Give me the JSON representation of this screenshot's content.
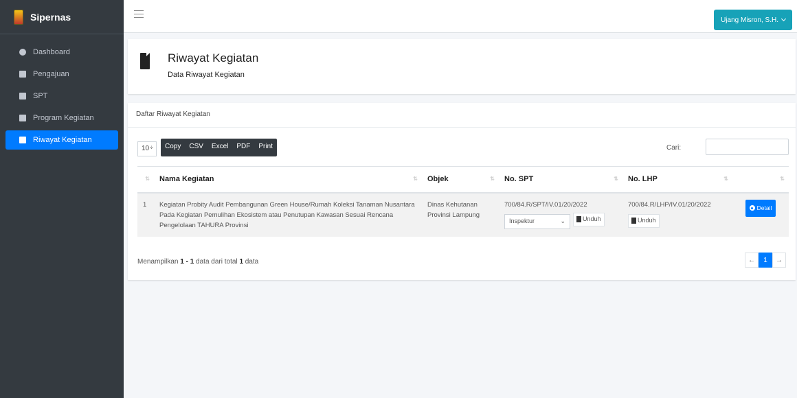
{
  "app": {
    "brand": "Sipernas"
  },
  "sidebar": {
    "items": [
      {
        "label": "Dashboard",
        "icon": "dashboard-icon"
      },
      {
        "label": "Pengajuan",
        "icon": "file-icon"
      },
      {
        "label": "SPT",
        "icon": "file-icon"
      },
      {
        "label": "Program Kegiatan",
        "icon": "file-icon"
      },
      {
        "label": "Riwayat Kegiatan",
        "icon": "file-icon",
        "active": true
      }
    ]
  },
  "topbar": {
    "user": "Ujang Misron, S.H."
  },
  "header": {
    "title": "Riwayat Kegiatan",
    "subtitle": "Data Riwayat Kegiatan"
  },
  "card": {
    "title": "Daftar Riwayat Kegiatan",
    "length_value": "10",
    "buttons": [
      "Copy",
      "CSV",
      "Excel",
      "PDF",
      "Print"
    ],
    "search_label": "Cari:",
    "columns": [
      "Nama Kegiatan",
      "Objek",
      "No. SPT",
      "No. LHP"
    ],
    "rows": [
      {
        "index": "1",
        "nama": "Kegiatan Probity Audit Pembangunan Green House/Rumah Koleksi Tanaman Nusantara Pada Kegiatan Pemulihan Ekosistem atau Penutupan Kawasan Sesuai Rencana Pengelolaan TAHURA Provinsi",
        "objek": "Dinas Kehutanan Provinsi Lampung",
        "no_spt": "700/84.R/SPT/IV.01/20/2022",
        "spt_select": "Inspektur",
        "spt_download": "Unduh",
        "no_lhp": "700/84.R/LHP/IV.01/20/2022",
        "lhp_download": "Unduh",
        "detail": "Detail"
      }
    ],
    "info_prefix": "Menampilkan ",
    "info_range": "1 - 1",
    "info_mid": " data dari total ",
    "info_total": "1",
    "info_suffix": " data",
    "pager": {
      "prev": "←",
      "current": "1",
      "next": "→"
    }
  },
  "colors": {
    "sidebar": "#343a40",
    "primary": "#007bff",
    "user_button": "#17a2b8"
  }
}
